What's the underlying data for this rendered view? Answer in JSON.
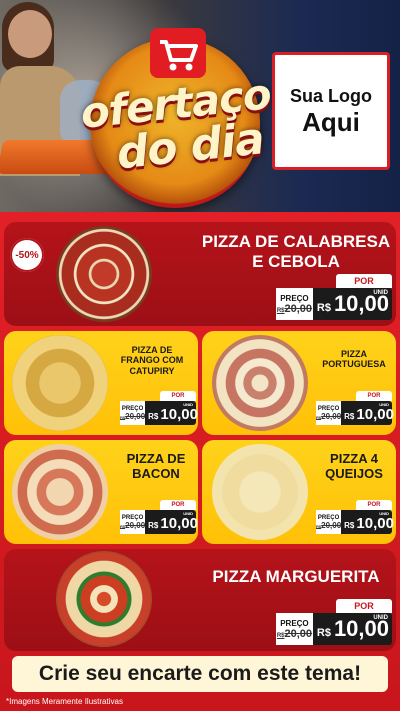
{
  "header": {
    "badge_line1": "ofertaço",
    "badge_line2": "do dia",
    "logo_line1": "Sua Logo",
    "logo_line2": "Aqui"
  },
  "products": [
    {
      "name_line1": "PIZZA DE CALABRESA",
      "name_line2": "E CEBOLA",
      "discount": "-50%",
      "por": "POR",
      "preco_label": "PREÇO",
      "old_price": "20,00",
      "old_currency": "R$",
      "currency": "R$",
      "price": "10,00",
      "unit": "UNID"
    },
    {
      "name_line1": "PIZZA DE",
      "name_line2": "FRANGO COM",
      "name_line3": "CATUPIRY",
      "por": "POR",
      "preco_label": "PREÇO",
      "old_price": "20,00",
      "old_currency": "R$",
      "currency": "R$",
      "price": "10,00",
      "unit": "UNID"
    },
    {
      "name_line1": "PIZZA",
      "name_line2": "PORTUGUESA",
      "por": "POR",
      "preco_label": "PREÇO",
      "old_price": "20,00",
      "old_currency": "R$",
      "currency": "R$",
      "price": "10,00",
      "unit": "UNID"
    },
    {
      "name_line1": "PIZZA DE",
      "name_line2": "BACON",
      "por": "POR",
      "preco_label": "PREÇO",
      "old_price": "20,00",
      "old_currency": "R$",
      "currency": "R$",
      "price": "10,00",
      "unit": "UNID"
    },
    {
      "name_line1": "PIZZA 4",
      "name_line2": "QUEIJOS",
      "por": "POR",
      "preco_label": "PREÇO",
      "old_price": "20,00",
      "old_currency": "R$",
      "currency": "R$",
      "price": "10,00",
      "unit": "UNID"
    },
    {
      "name_line1": "PIZZA MARGUERITA",
      "por": "POR",
      "preco_label": "PREÇO",
      "old_price": "20,00",
      "old_currency": "R$",
      "currency": "R$",
      "price": "10,00",
      "unit": "UNID"
    }
  ],
  "cta": "Crie seu encarte com este tema!",
  "footnote": "*Imagens Meramente Ilustrativas",
  "colors": {
    "red": "#c8161c",
    "yellow": "#ffc107",
    "dark": "#1b1b1b"
  }
}
